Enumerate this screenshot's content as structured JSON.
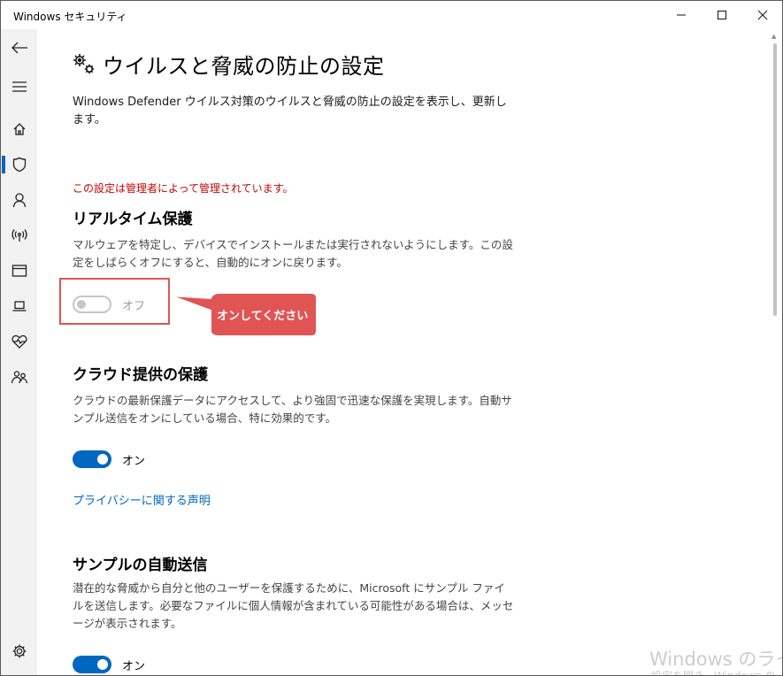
{
  "window": {
    "title": "Windows セキュリティ"
  },
  "nav": {
    "items": [
      "back-icon",
      "menu-icon",
      "home-icon",
      "shield-icon",
      "person-icon",
      "network-icon",
      "app-browser-icon",
      "device-icon",
      "heart-icon",
      "family-icon",
      "settings-icon"
    ],
    "active": "shield-icon"
  },
  "page": {
    "title": "ウイルスと脅威の防止の設定",
    "description": "Windows Defender ウイルス対策のウイルスと脅威の防止の設定を表示し、更新します。",
    "admin_warning": "この設定は管理者によって管理されています。"
  },
  "realtime": {
    "title": "リアルタイム保護",
    "description": "マルウェアを特定し、デバイスでインストールまたは実行されないようにします。この設定をしばらくオフにすると、自動的にオンに戻ります。",
    "state": "オフ",
    "is_on": false
  },
  "annotation": {
    "callout_text": "オンしてください",
    "color": "#e05454"
  },
  "cloud": {
    "title": "クラウド提供の保護",
    "description": "クラウドの最新保護データにアクセスして、より強固で迅速な保護を実現します。自動サンプル送信をオンにしている場合、特に効果的です。",
    "state": "オン",
    "is_on": true
  },
  "privacy_link": "プライバシーに関する声明",
  "sample": {
    "title": "サンプルの自動送信",
    "description": "潜在的な脅威から自分と他のユーザーを保護するために、Microsoft にサンプル ファイルを送信します。必要なファイルに個人情報が含まれている可能性がある場合は、メッセージが表示されます。",
    "state": "オン",
    "is_on": true
  },
  "watermark": {
    "line1": "Windows のライセ",
    "line2": "設定を開き、Windows の"
  },
  "colors": {
    "accent": "#0067c0",
    "warning": "#c50500",
    "rail_bg": "#f2f2f2"
  }
}
